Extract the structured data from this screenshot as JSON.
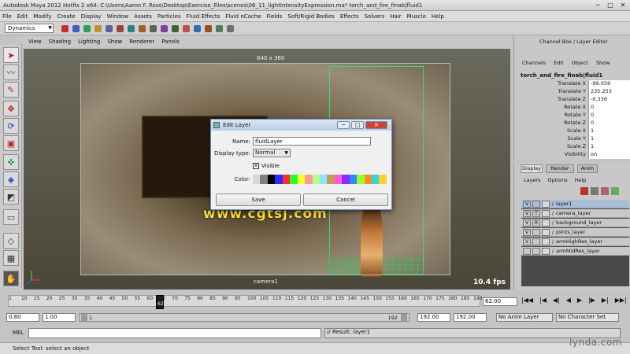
{
  "window": {
    "title": "Autodesk Maya 2012 Hotfix 2 x64: C:\\Users\\Aaron F. Ross\\Desktop\\Exercise_Files\\scenes\\06_11_lightIntensityExpression.ma*    torch_and_fire_finab|fluid1",
    "controls": [
      "─",
      "□",
      "✕"
    ]
  },
  "menubar": [
    "File",
    "Edit",
    "Modify",
    "Create",
    "Display",
    "Window",
    "Assets",
    "Particles",
    "Fluid Effects",
    "Fluid nCache",
    "Fields",
    "Soft/Rigid Bodies",
    "Effects",
    "Solvers",
    "Hair",
    "Muscle",
    "Help"
  ],
  "statusline": {
    "mode": "Dynamics"
  },
  "panel_menu": [
    "View",
    "Shading",
    "Lighting",
    "Show",
    "Renderer",
    "Panels"
  ],
  "viewport": {
    "resolution": "640 x 360",
    "camera": "camera1",
    "fps": "10.4 fps",
    "watermark": "www.cgtsj.com"
  },
  "dialog": {
    "title": "Edit Layer",
    "name_label": "Name:",
    "name_value": "fluidLayer",
    "display_type_label": "Display type:",
    "display_type_value": "Normal",
    "visible_label": "Visible",
    "color_label": "Color:",
    "save_label": "Save",
    "cancel_label": "Cancel",
    "palette": [
      "#d8d8d8",
      "#808080",
      "#000000",
      "#2a2aff",
      "#ff2a2a",
      "#2aff2a",
      "#ffff2a",
      "#ff9a9a",
      "#b8ff8a",
      "#8ae6ff",
      "#c89a5a",
      "#ff5ad0",
      "#8a2aff",
      "#2a8aff",
      "#9aff2a",
      "#ff8a2a",
      "#2adcdc",
      "#ffd02a"
    ]
  },
  "channel_box": {
    "header": "Channel Box / Layer Editor",
    "menus": [
      "Channels",
      "Edit",
      "Object",
      "Show"
    ],
    "object": "torch_and_fire_finab|fluid1",
    "attributes": [
      {
        "name": "Translate X",
        "value": "-99.059"
      },
      {
        "name": "Translate Y",
        "value": "235.253"
      },
      {
        "name": "Translate Z",
        "value": "-0.336"
      },
      {
        "name": "Rotate X",
        "value": "0"
      },
      {
        "name": "Rotate Y",
        "value": "0"
      },
      {
        "name": "Rotate Z",
        "value": "0"
      },
      {
        "name": "Scale X",
        "value": "1"
      },
      {
        "name": "Scale Y",
        "value": "1"
      },
      {
        "name": "Scale Z",
        "value": "1"
      },
      {
        "name": "Visibility",
        "value": "on"
      }
    ]
  },
  "layer_editor": {
    "tabs": [
      "Display",
      "Render",
      "Anim"
    ],
    "menus": [
      "Layers",
      "Options",
      "Help"
    ],
    "layers": [
      {
        "v": "V",
        "t": "",
        "name": "layer1"
      },
      {
        "v": "V",
        "t": "T",
        "name": "camera_layer"
      },
      {
        "v": "V",
        "t": "R",
        "name": "background_layer"
      },
      {
        "v": "V",
        "t": "",
        "name": "joints_layer"
      },
      {
        "v": "V",
        "t": "",
        "name": "armHighRes_layer"
      },
      {
        "v": "",
        "t": "",
        "name": "armMidRes_layer"
      }
    ]
  },
  "timeline": {
    "ticks": [
      "1",
      "10",
      "15",
      "20",
      "25",
      "30",
      "35",
      "40",
      "45",
      "50",
      "55",
      "60",
      "65",
      "70",
      "75",
      "80",
      "85",
      "90",
      "95",
      "100",
      "105",
      "110",
      "115",
      "120",
      "125",
      "130",
      "135",
      "140",
      "145",
      "150",
      "155",
      "160",
      "165",
      "170",
      "175",
      "180",
      "185",
      "190"
    ],
    "current_frame": "62",
    "frame_field": "62.00"
  },
  "range": {
    "start": "0.80",
    "playback_start": "1.00",
    "range_left": "1",
    "range_right": "192",
    "playback_end": "192.00",
    "end": "192.00",
    "anim_layer": "No Anim Layer",
    "character_set": "No Character Set"
  },
  "mel": {
    "label": "MEL",
    "result": "// Result: layer1"
  },
  "help": {
    "text": "Select Tool: select an object"
  },
  "brand": "lynda.com"
}
